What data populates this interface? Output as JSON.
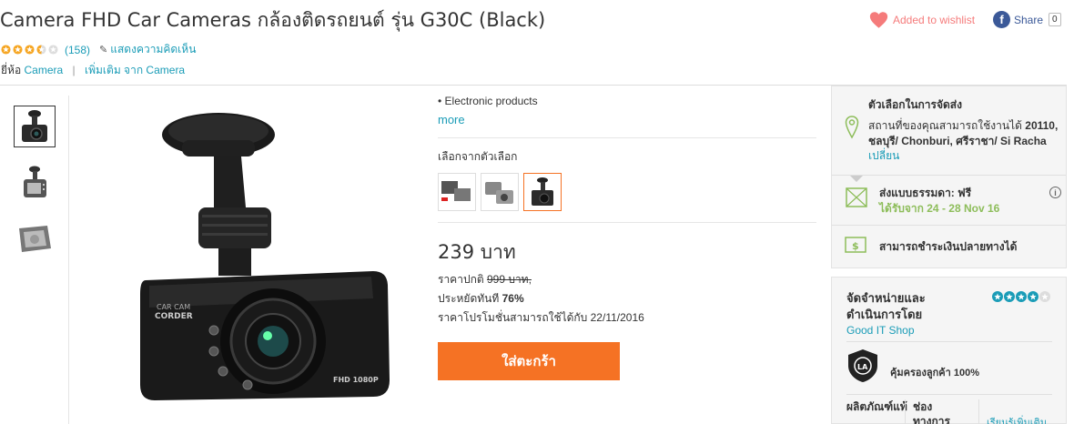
{
  "product": {
    "title": "Camera FHD Car Cameras กล้องติดรถยนต์ รุ่น G30C (Black)",
    "rating_value": 3.5,
    "rating_count": "(158)",
    "review_link": "แสดงความคิดเห็น",
    "brand_prefix": "ยี่ห้อ",
    "brand": "Camera",
    "brand_more": "เพิ่มเติม จาก Camera"
  },
  "header": {
    "wishlist": "Added to wishlist",
    "share": "Share",
    "share_count": "0"
  },
  "details": {
    "bullet": "Electronic products",
    "more": "more",
    "choose_label": "เลือกจากตัวเลือก",
    "price": "239 บาท",
    "orig_prefix": "ราคาปกติ",
    "orig_price": "999 บาท,",
    "save_prefix": "ประหยัดทันที",
    "save_pct": "76%",
    "promo": "ราคาโปรโมชั่นสามารถใช้ได้กับ 22/11/2016",
    "cart_button": "ใส่ตะกร้า"
  },
  "delivery": {
    "title": "ตัวเลือกในการจัดส่ง",
    "location_prefix": "สถานที่ของคุณสามารถใช้งานได้ ",
    "location": "20110, ชลบุรี/ Chonburi, ศรีราชา/ Si Racha",
    "change": "เปลี่ยน",
    "ship_label": "ส่งแบบธรรมดา: ฟรี",
    "ship_date": "ได้รับจาก 24 - 28 Nov 16",
    "cod": "สามารถชำระเงินปลายทางได้"
  },
  "seller": {
    "title": "จัดจำหน่ายและดำเนินการโดย",
    "name": "Good IT Shop",
    "rating_value": 4,
    "guarantee": "คุ้มครองลูกค้า 100%",
    "col1": "ผลิตภัณฑ์แท้",
    "col2": "ช่องทางการ",
    "col3": "เรียนรู้เพิ่มเติม"
  },
  "colors": {
    "accent": "#f57224",
    "link": "#1a9cb7",
    "star": "#f6a623",
    "seller_star": "#1a9cb7"
  }
}
